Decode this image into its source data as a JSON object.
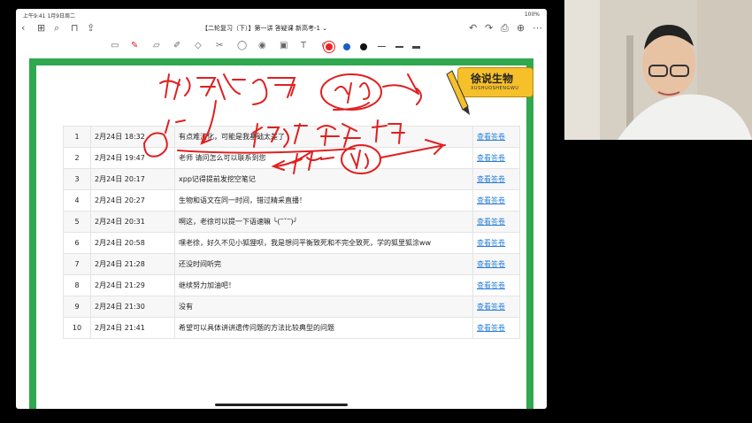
{
  "status": {
    "time": "上午9:41  1月9日周二",
    "battery": "100%"
  },
  "navbar": {
    "title": "【二轮复习（下）】第一讲 答疑课  新高考-1 ⌄"
  },
  "logo": {
    "cn": "徐说生物",
    "en": "XUSHUOSHENGWU"
  },
  "table": {
    "rows": [
      {
        "num": "1",
        "date": "2月24日 18:32",
        "msg": "有点难消化，可能是我基础太差了",
        "link": "查看答卷"
      },
      {
        "num": "2",
        "date": "2月24日 19:47",
        "msg": "老师 请问怎么可以联系到您",
        "link": "查看答卷"
      },
      {
        "num": "3",
        "date": "2月24日 20:17",
        "msg": "xpp记得提前发挖空笔记",
        "link": "查看答卷"
      },
      {
        "num": "4",
        "date": "2月24日 20:27",
        "msg": "生物和语文在同一时间，错过精采直播！",
        "link": "查看答卷"
      },
      {
        "num": "5",
        "date": "2月24日 20:31",
        "msg": "啊这，老徐可以提一下语速嘛 ╰(‾ˇ‾)╯",
        "link": "查看答卷"
      },
      {
        "num": "6",
        "date": "2月24日 20:58",
        "msg": "嘿老徐，好久不见小狐狸呗，我是想问平衡致死和不完全致死，学的狐里狐涂ww",
        "link": "查看答卷"
      },
      {
        "num": "7",
        "date": "2月24日 21:28",
        "msg": "还没时间听完",
        "link": "查看答卷"
      },
      {
        "num": "8",
        "date": "2月24日 21:29",
        "msg": "继续努力加油吧！",
        "link": "查看答卷"
      },
      {
        "num": "9",
        "date": "2月24日 21:30",
        "msg": "没有",
        "link": "查看答卷"
      },
      {
        "num": "10",
        "date": "2月24日 21:41",
        "msg": "希望可以具体讲讲遗传问题的方法比较典型的问题",
        "link": "查看答卷"
      }
    ]
  },
  "colors": {
    "slide_border": "#2fa84f",
    "link": "#2a7fd6",
    "ink": "#e02020"
  },
  "icons": [
    "back-icon",
    "grid-icon",
    "search-icon",
    "bookmark-icon",
    "share-icon",
    "undo-icon",
    "redo-icon",
    "export-icon",
    "more-icon",
    "pen-icon",
    "eraser-icon",
    "lasso-icon",
    "text-icon",
    "image-icon"
  ]
}
